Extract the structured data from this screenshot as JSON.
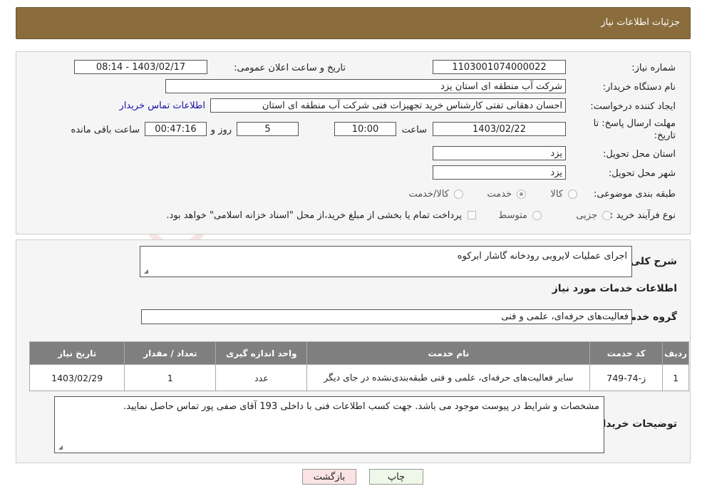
{
  "header": {
    "title": "جزئیات اطلاعات نیاز"
  },
  "form": {
    "need_number_label": "شماره نیاز:",
    "need_number": "1103001074000022",
    "announce_label": "تاریخ و ساعت اعلان عمومی:",
    "announce_value": "1403/02/17 - 08:14",
    "buyer_org_label": "نام دستگاه خریدار:",
    "buyer_org": "شرکت آب منطقه ای استان یزد",
    "requester_label": "ایجاد کننده درخواست:",
    "requester": "احسان دهقانی تفتی کارشناس خرید تجهیزات فنی شرکت آب منطقه ای استان",
    "contact_link": "اطلاعات تماس خریدار",
    "deadline_label_1": "مهلت ارسال پاسخ: تا",
    "deadline_label_2": "تاریخ:",
    "deadline_date": "1403/02/22",
    "time_label": "ساعت",
    "deadline_time": "10:00",
    "days_value": "5",
    "days_label": "روز و",
    "remaining_time": "00:47:16",
    "remaining_label": "ساعت باقی مانده",
    "province_label": "استان محل تحویل:",
    "province": "یزد",
    "city_label": "شهر محل تحویل:",
    "city": "یزد",
    "category_label": "طبقه بندی موضوعی:",
    "category_options": [
      "کالا",
      "خدمت",
      "کالا/خدمت"
    ],
    "category_selected": "خدمت",
    "process_label": "نوع فرآیند خرید :",
    "process_options": [
      "جزیی",
      "متوسط"
    ],
    "payment_note": "پرداخت تمام یا بخشی از مبلغ خرید،از محل \"اسناد خزانه اسلامی\" خواهد بود."
  },
  "details": {
    "summary_label": "شرح کلی نیاز:",
    "summary": "اجرای عملیات لایروبی رودخانه گاشار ابرکوه",
    "services_heading": "اطلاعات خدمات مورد نیاز",
    "service_group_label": "گروه خدمت:",
    "service_group": "فعالیت‌های حرفه‌ای، علمی و فنی",
    "table": {
      "headers": [
        "ردیف",
        "کد خدمت",
        "نام خدمت",
        "واحد اندازه گیری",
        "تعداد / مقدار",
        "تاریخ نیاز"
      ],
      "rows": [
        [
          "1",
          "ز-74-749",
          "سایر فعالیت‌های حرفه‌ای، علمی و فنی طبقه‌بندی‌نشده در جای دیگر",
          "عدد",
          "1",
          "1403/02/29"
        ]
      ]
    },
    "buyer_notes_label": "توضیحات خریدار:",
    "buyer_notes": "مشخصات و شرایط در پیوست موجود می باشد. جهت کسب اطلاعات فنی با داخلی 193 آقای صفی پور تماس حاصل نمایید."
  },
  "buttons": {
    "print": "چاپ",
    "back": "بازگشت"
  },
  "watermark": "AriaTender.neT",
  "colors": {
    "header_bg": "#8b6d3d",
    "table_header_bg": "#7f7f7f",
    "back_button_bg": "#fbe3e3",
    "print_button_bg": "#eef7e8"
  }
}
